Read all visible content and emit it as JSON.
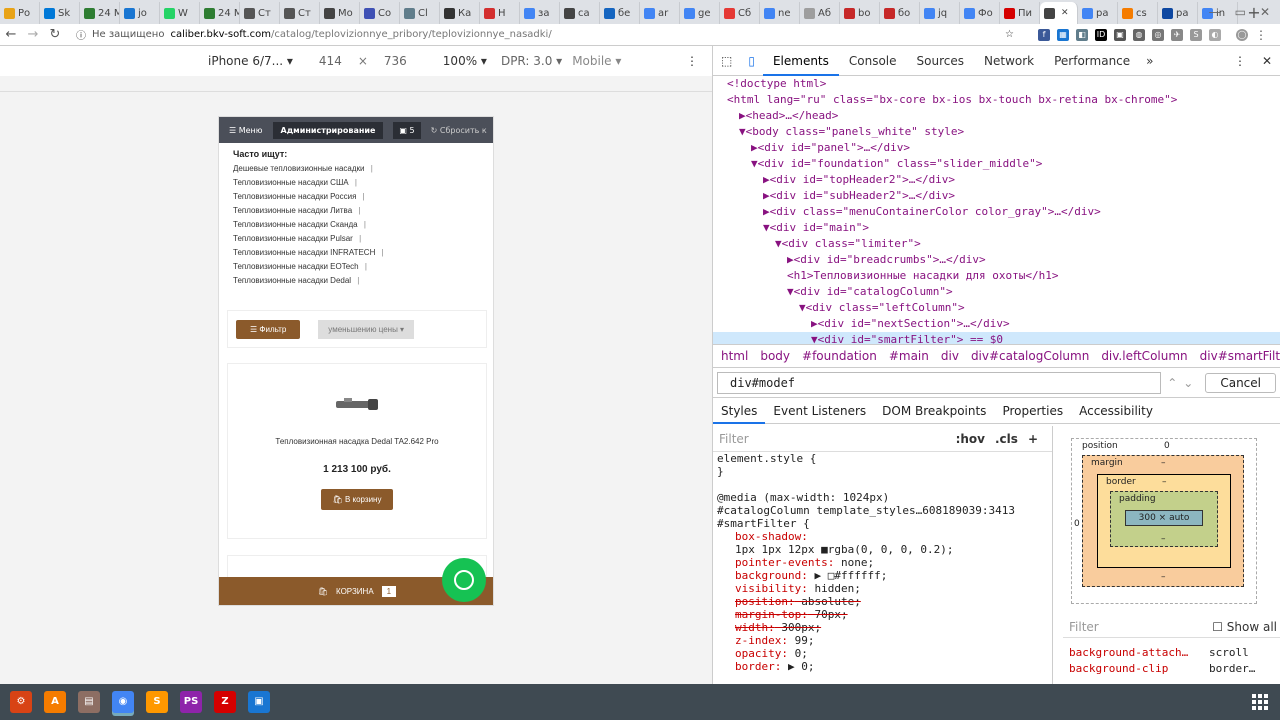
{
  "browser": {
    "tabs": [
      {
        "label": "Ро",
        "color": "#e8a317"
      },
      {
        "label": "Sk",
        "color": "#0078d7"
      },
      {
        "label": "24 М",
        "color": "#2e7d32"
      },
      {
        "label": "jo",
        "color": "#1976d2"
      },
      {
        "label": "W",
        "color": "#25d366"
      },
      {
        "label": "24 М",
        "color": "#2e7d32"
      },
      {
        "label": "Ст",
        "color": "#555555"
      },
      {
        "label": "Ст",
        "color": "#555555"
      },
      {
        "label": "Мо",
        "color": "#444444"
      },
      {
        "label": "Co",
        "color": "#3f51b5"
      },
      {
        "label": "Cl",
        "color": "#607d8b"
      },
      {
        "label": "Ка",
        "color": "#333333"
      },
      {
        "label": "Н",
        "color": "#d32f2f"
      },
      {
        "label": "за",
        "color": "#4285f4"
      },
      {
        "label": "ca",
        "color": "#444444"
      },
      {
        "label": "бе",
        "color": "#1565c0"
      },
      {
        "label": "ar",
        "color": "#4285f4"
      },
      {
        "label": "ge",
        "color": "#4285f4"
      },
      {
        "label": "Сб",
        "color": "#e53935"
      },
      {
        "label": "ne",
        "color": "#4285f4"
      },
      {
        "label": "Аб",
        "color": "#9e9e9e"
      },
      {
        "label": "bo",
        "color": "#c62828"
      },
      {
        "label": "бо",
        "color": "#c62828"
      },
      {
        "label": "jq",
        "color": "#4285f4"
      },
      {
        "label": "Фо",
        "color": "#4285f4"
      },
      {
        "label": "Пи",
        "color": "#d50000"
      },
      {
        "label": "",
        "color": "#444444",
        "active": true
      },
      {
        "label": "ра",
        "color": "#4285f4"
      },
      {
        "label": "cs",
        "color": "#f57c00"
      },
      {
        "label": "ра",
        "color": "#0d47a1"
      },
      {
        "label": "in",
        "color": "#4285f4"
      }
    ],
    "new_tab": "+",
    "back": "←",
    "forward": "→",
    "reload": "↻",
    "security_label": "Не защищено",
    "url_host": "caliber.bkv-soft.com",
    "url_path": "/catalog/teplovizionnye_pribory/teplovizionnye_nasadki/"
  },
  "device_toolbar": {
    "device": "iPhone 6/7...",
    "width": "414",
    "times": "×",
    "height": "736",
    "zoom": "100%",
    "dpr": "DPR: 3.0",
    "mode": "Mobile"
  },
  "site": {
    "menu": "Меню",
    "admin": "Администрирование",
    "badge_count": "5",
    "reset": "Сбросить к",
    "popular_title": "Часто ищут:",
    "popular": [
      "Дешевые тепловизионные насадки",
      "Тепловизионные насадки США",
      "Тепловизионные насадки Россия",
      "Тепловизионные насадки Литва",
      "Тепловизионные насадки Сканда",
      "Тепловизионные насадки Pulsar",
      "Тепловизионные насадки INFRATECH",
      "Тепловизионные насадки EOTech",
      "Тепловизионные насадки Dedal"
    ],
    "filter_btn": "Фильтр",
    "sort_select": "уменьшению цены",
    "product_name": "Тепловизионная насадка Dedal TA2.642 Pro",
    "product_price": "1 213 100 руб.",
    "buy_btn": "В корзину",
    "cart_label": "КОРЗИНА",
    "cart_count": "1",
    "brand_color": "#8b5a2b"
  },
  "devtools": {
    "tabs": [
      "Elements",
      "Console",
      "Sources",
      "Network",
      "Performance"
    ],
    "more": "»",
    "dom": [
      {
        "t": "<!doctype html>",
        "i": 0
      },
      {
        "t": "<html lang=\"ru\" class=\"bx-core bx-ios bx-touch bx-retina bx-chrome\">",
        "i": 0
      },
      {
        "t": "▶<head>…</head>",
        "i": 1
      },
      {
        "t": "▼<body class=\"panels_white\" style>",
        "i": 1
      },
      {
        "t": "▶<div id=\"panel\">…</div>",
        "i": 2
      },
      {
        "t": "▼<div id=\"foundation\" class=\"slider_middle\">",
        "i": 2
      },
      {
        "t": "▶<div id=\"topHeader2\">…</div>",
        "i": 3
      },
      {
        "t": "▶<div id=\"subHeader2\">…</div>",
        "i": 3
      },
      {
        "t": "▶<div class=\"menuContainerColor color_gray\">…</div>",
        "i": 3
      },
      {
        "t": "▼<div id=\"main\">",
        "i": 3
      },
      {
        "t": "▼<div class=\"limiter\">",
        "i": 4
      },
      {
        "t": "▶<div id=\"breadcrumbs\">…</div>",
        "i": 5
      },
      {
        "t": "<h1>Тепловизионные насадки для охоты</h1>",
        "i": 5
      },
      {
        "t": "▼<div id=\"catalogColumn\">",
        "i": 5
      },
      {
        "t": "▼<div class=\"leftColumn\">",
        "i": 6
      },
      {
        "t": "▶<div id=\"nextSection\">…</div>",
        "i": 7
      },
      {
        "t": "▼<div id=\"smartFilter\"> == $0",
        "i": 7,
        "sel": true
      }
    ],
    "crumbs": [
      "html",
      "body",
      "#foundation",
      "#main",
      "div",
      "div#catalogColumn",
      "div.leftColumn",
      "div#smartFilter"
    ],
    "search_value": "div#modef",
    "cancel": "Cancel",
    "subtabs": [
      "Styles",
      "Event Listeners",
      "DOM Breakpoints",
      "Properties",
      "Accessibility"
    ],
    "filter_placeholder": "Filter",
    "hov": ":hov",
    "cls": ".cls",
    "plus": "+",
    "style_lines": [
      {
        "k": "sel",
        "t": "element.style {"
      },
      {
        "k": "sel",
        "t": "}"
      },
      {
        "k": "sel",
        "t": ""
      },
      {
        "k": "sel",
        "t": "@media (max-width: 1024px)"
      },
      {
        "k": "sel",
        "t": "#catalogColumn      template_styles…608189039:3413"
      },
      {
        "k": "sel",
        "t": "#smartFilter {"
      },
      {
        "k": "p",
        "n": "box-shadow:",
        "v": ""
      },
      {
        "k": "p",
        "n": "",
        "v": "    1px 1px 12px ■rgba(0, 0, 0, 0.2);"
      },
      {
        "k": "p",
        "n": "pointer-events:",
        "v": " none;"
      },
      {
        "k": "p",
        "n": "background:",
        "v": " ▶ □#ffffff;"
      },
      {
        "k": "p",
        "n": "visibility:",
        "v": " hidden;"
      },
      {
        "k": "ps",
        "n": "position:",
        "v": " absolute;"
      },
      {
        "k": "ps",
        "n": "margin-top:",
        "v": " 70px;"
      },
      {
        "k": "ps",
        "n": "width:",
        "v": " 300px;"
      },
      {
        "k": "p",
        "n": "z-index:",
        "v": " 99;"
      },
      {
        "k": "p",
        "n": "opacity:",
        "v": " 0;"
      },
      {
        "k": "p",
        "n": "border:",
        "v": " ▶ 0;"
      }
    ],
    "boxmodel": {
      "position_label": "position",
      "position_val": "0",
      "margin_label": "margin",
      "border_label": "border",
      "padding_label": "padding",
      "content": "300 × auto",
      "dash": "–",
      "zero": "0"
    },
    "computed_filter": "Filter",
    "show_all": "Show all",
    "computed": [
      {
        "n": "background-attach…",
        "v": "scroll"
      },
      {
        "n": "background-clip",
        "v": "border…"
      }
    ]
  },
  "taskbar": [
    {
      "name": "settings-app",
      "label": "⚙",
      "color": "#d84315"
    },
    {
      "name": "store-app",
      "label": "A",
      "color": "#f57c00"
    },
    {
      "name": "files-app",
      "label": "▤",
      "color": "#8d6e63"
    },
    {
      "name": "chrome-app",
      "label": "◉",
      "color": "#4285f4"
    },
    {
      "name": "sublime-app",
      "label": "S",
      "color": "#ff9800"
    },
    {
      "name": "phpstorm-app",
      "label": "PS",
      "color": "#8e24aa"
    },
    {
      "name": "filezilla-app",
      "label": "Z",
      "color": "#d50000"
    },
    {
      "name": "terminal-app",
      "label": "▣",
      "color": "#1976d2"
    }
  ]
}
